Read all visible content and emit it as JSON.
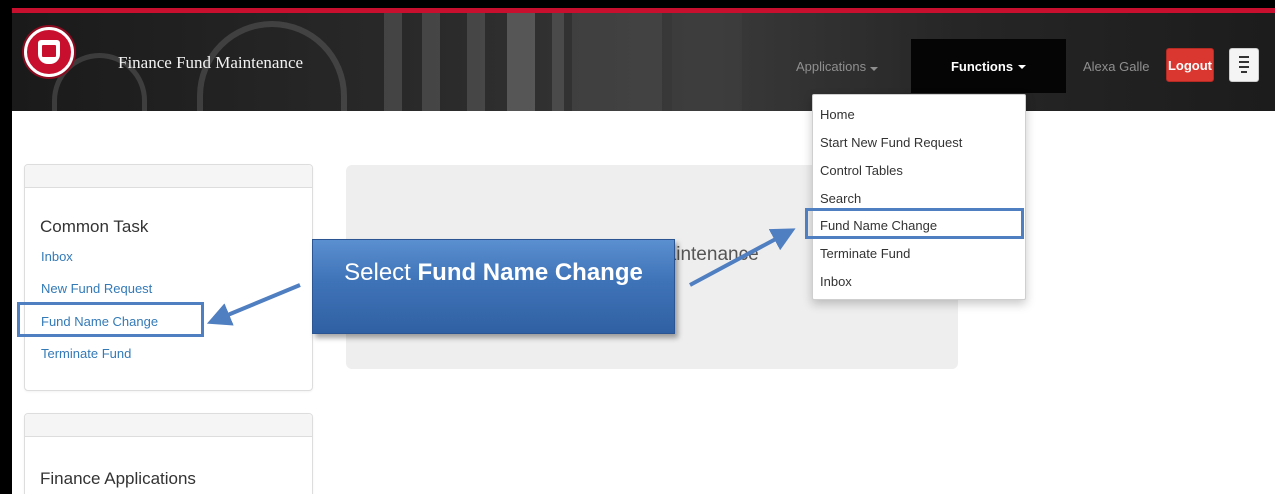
{
  "header": {
    "app_title": "Finance Fund Maintenance",
    "nav": {
      "applications": "Applications",
      "functions": "Functions",
      "user": "Alexa Galle",
      "logout": "Logout"
    }
  },
  "functions_menu": {
    "items": [
      "Home",
      "Start New Fund Request",
      "Control Tables",
      "Search",
      "Fund Name Change",
      "Terminate Fund",
      "Inbox"
    ],
    "highlighted": "Fund Name Change"
  },
  "sidebar": {
    "common_task": {
      "title": "Common Task",
      "links": [
        "Inbox",
        "New Fund Request",
        "Fund Name Change",
        "Terminate Fund"
      ]
    },
    "finance_applications": {
      "title": "Finance Applications"
    }
  },
  "main": {
    "jumbotron_text": "d Maintenance"
  },
  "callout": {
    "prefix": "Select ",
    "bold": "Fund Name Change"
  },
  "colors": {
    "brand_red": "#c8102e",
    "logout_red": "#d9372f",
    "link_blue": "#337ab7",
    "highlight_blue": "#4f7ec1",
    "callout_blue": "#3f73b8"
  },
  "icons": {
    "menu_toggle": "menu-toggle-icon",
    "logo": "university-seal-icon"
  }
}
